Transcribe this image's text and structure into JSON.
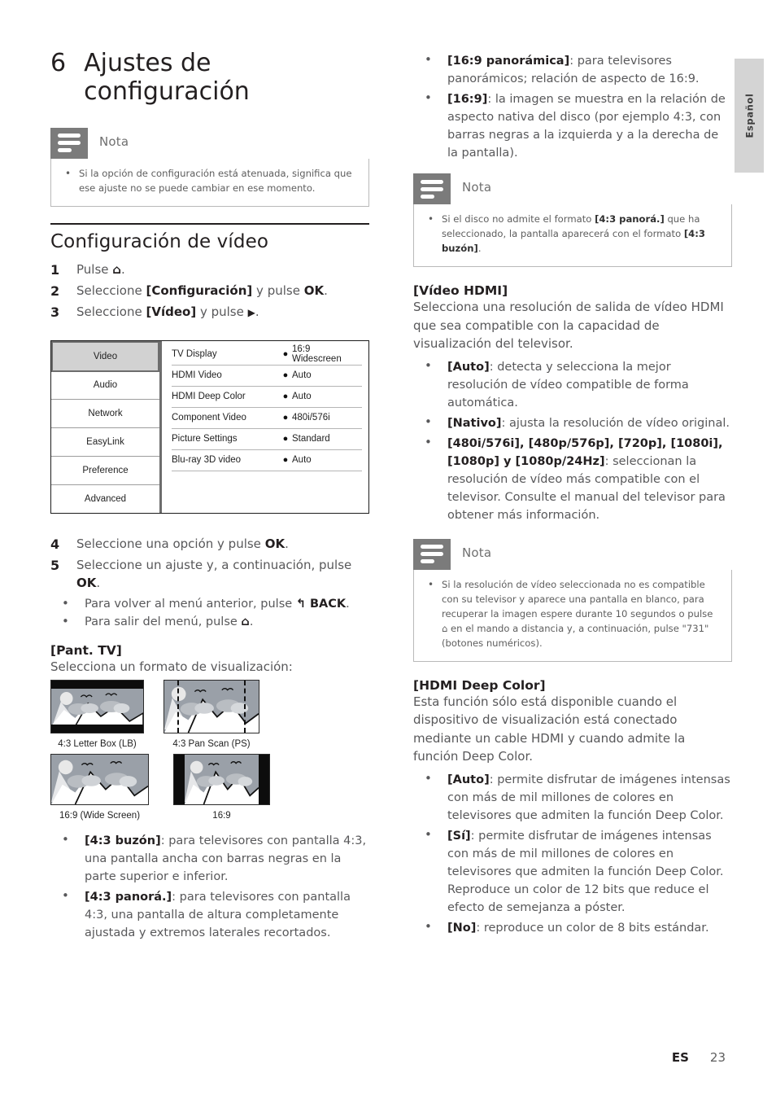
{
  "chapter": {
    "number": "6",
    "title": "Ajustes de configuración"
  },
  "side_tab": {
    "label": "Español"
  },
  "footer": {
    "locale": "ES",
    "page_number": "23"
  },
  "notes": {
    "label": "Nota",
    "note1": "Si la opción de configuración está atenuada, significa que ese ajuste no se puede cambiar en ese momento.",
    "note2_pre": "Si el disco no admite el formato ",
    "note2_b1": "[4:3 panorá.]",
    "note2_mid": " que ha seleccionado, la pantalla aparecerá con el formato ",
    "note2_b2": "[4:3 buzón]",
    "note2_post": ".",
    "note3": "Si la resolución de vídeo seleccionada no es compatible con su televisor y aparece una pantalla en blanco, para recuperar la imagen espere durante 10 segundos o pulse ⌂ en el mando a distancia y, a continuación, pulse \"731\" (botones numéricos)."
  },
  "video_section": {
    "heading": "Configuración de vídeo",
    "steps": [
      {
        "n": "1",
        "pre": "Pulse ",
        "bold": "",
        "post": "."
      },
      {
        "n": "2",
        "pre": "Seleccione ",
        "bold": "[Configuración]",
        "mid": " y pulse ",
        "bold2": "OK",
        "post": "."
      },
      {
        "n": "3",
        "pre": "Seleccione ",
        "bold": "[Vídeo]",
        "mid": " y pulse ",
        "post": "."
      },
      {
        "n": "4",
        "pre": "Seleccione una opción y pulse ",
        "bold": "OK",
        "post": "."
      },
      {
        "n": "5",
        "pre": "Seleccione un ajuste y, a continuación, pulse ",
        "bold": "OK",
        "post": "."
      }
    ],
    "substeps": [
      {
        "pre": "Para volver al menú anterior, pulse ",
        "bold": "BACK",
        "post": "."
      },
      {
        "pre": "Para salir del menú, pulse ",
        "bold": "",
        "post": "."
      }
    ]
  },
  "menu_screenshot": {
    "sidebar": [
      {
        "label": "Video",
        "selected": true
      },
      {
        "label": "Audio",
        "selected": false
      },
      {
        "label": "Network",
        "selected": false
      },
      {
        "label": "EasyLink",
        "selected": false
      },
      {
        "label": "Preference",
        "selected": false
      },
      {
        "label": "Advanced",
        "selected": false
      }
    ],
    "rows": [
      {
        "label": "TV Display",
        "value": "16:9 Widescreen"
      },
      {
        "label": "HDMI Video",
        "value": "Auto"
      },
      {
        "label": "HDMI Deep Color",
        "value": "Auto"
      },
      {
        "label": "Component Video",
        "value": "480i/576i"
      },
      {
        "label": "Picture Settings",
        "value": "Standard"
      },
      {
        "label": "Blu-ray 3D video",
        "value": "Auto"
      }
    ],
    "bullet_glyph": "●"
  },
  "tv_display": {
    "heading": "[Pant. TV]",
    "intro": "Selecciona un formato de visualización:",
    "figures": [
      {
        "caption": "4:3 Letter Box (LB)"
      },
      {
        "caption": "4:3 Pan Scan (PS)"
      },
      {
        "caption": "16:9 (Wide Screen)"
      },
      {
        "caption": "16:9"
      }
    ],
    "bullets": [
      {
        "bold": "[4:3 buzón]",
        "text": ": para televisores con pantalla 4:3, una pantalla ancha con barras negras en la parte superior e inferior."
      },
      {
        "bold": "[4:3 panorá.]",
        "text": ": para televisores con pantalla 4:3, una pantalla de altura completamente ajustada y extremos laterales recortados."
      },
      {
        "bold": "[16:9 panorámica]",
        "text": ": para televisores panorámicos; relación de aspecto de 16:9."
      },
      {
        "bold": "[16:9]",
        "text": ": la imagen se muestra en la relación de aspecto nativa del disco (por ejemplo 4:3, con barras negras a la izquierda y a la derecha de la pantalla)."
      }
    ]
  },
  "hdmi_video": {
    "heading": "[Vídeo HDMI]",
    "intro": "Selecciona una resolución de salida de vídeo HDMI que sea compatible con la capacidad de visualización del televisor.",
    "bullets": [
      {
        "bold": "[Auto]",
        "text": ": detecta y selecciona la mejor resolución de vídeo compatible de forma automática."
      },
      {
        "bold": "[Nativo]",
        "text": ": ajusta la resolución de vídeo original."
      },
      {
        "bold": "[480i/576i], [480p/576p], [720p], [1080i], [1080p] y [1080p/24Hz]",
        "text": ": seleccionan la resolución de vídeo más compatible con el televisor. Consulte el manual del televisor para obtener más información."
      }
    ]
  },
  "hdmi_deep_color": {
    "heading": "[HDMI Deep Color]",
    "intro": "Esta función sólo está disponible cuando el dispositivo de visualización está conectado mediante un cable HDMI y cuando admite la función Deep Color.",
    "bullets": [
      {
        "bold": "[Auto]",
        "text": ": permite disfrutar de imágenes intensas con más de mil millones de colores en televisores que admiten la función Deep Color."
      },
      {
        "bold": "[Sí]",
        "text": ": permite disfrutar de imágenes intensas con más de mil millones de colores en televisores que admiten la función Deep Color. Reproduce un color de 12 bits que reduce el efecto de semejanza a póster."
      },
      {
        "bold": "[No]",
        "text": ": reproduce un color de 8 bits estándar."
      }
    ]
  },
  "colors": {
    "ink": "#231f20",
    "body_text": "#58585a",
    "note_gray": "#7b7b7b",
    "tab_gray": "#d4d4d4",
    "menu_selected": "#d2d2d2"
  }
}
